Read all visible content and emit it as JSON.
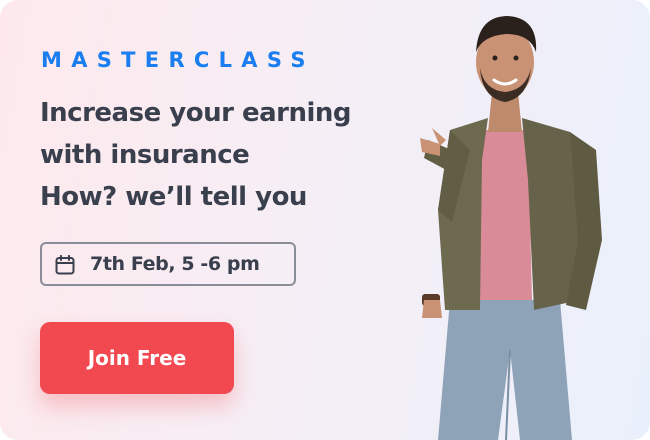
{
  "banner": {
    "eyebrow": "MASTERCLASS",
    "headline": [
      "Increase your earning",
      "with insurance",
      "How? we’ll tell you"
    ],
    "date": "7th Feb, 5 -6 pm",
    "cta_label": "Join Free",
    "icons": {
      "date": "calendar-icon"
    },
    "colors": {
      "accent": "#1a7ef0",
      "cta": "#f2484f",
      "headline": "#3a3f4e"
    }
  }
}
